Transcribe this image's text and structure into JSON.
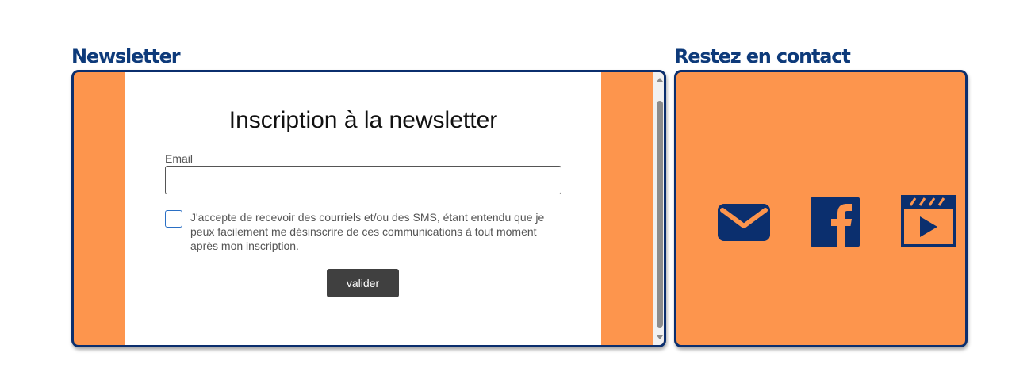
{
  "newsletter_section": {
    "title": "Newsletter",
    "form": {
      "heading": "Inscription à la newsletter",
      "email_label": "Email",
      "email_value": "",
      "consent_text": "J'accepte de recevoir des courriels et/ou des SMS, étant entendu que je peux facilement me désinscrire de ces communications à tout moment après mon inscription.",
      "consent_checked": false,
      "submit_label": "valider"
    }
  },
  "contact_section": {
    "title": "Restez en contact",
    "icons": [
      "mail-icon",
      "facebook-icon",
      "video-icon"
    ]
  },
  "colors": {
    "accent_orange": "#fd954d",
    "navy": "#0b2f6e",
    "button_dark": "#404040"
  }
}
